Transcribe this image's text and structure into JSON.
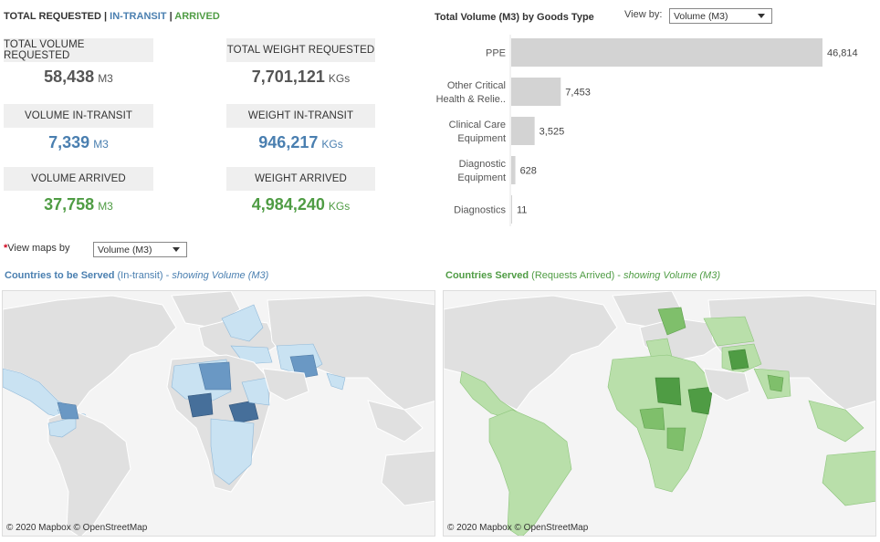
{
  "header": {
    "total": "TOTAL REQUESTED",
    "sep": "|",
    "transit": "IN-TRANSIT",
    "arrived": "ARRIVED"
  },
  "kpis": {
    "total_volume": {
      "label": "TOTAL VOLUME REQUESTED",
      "value": "58,438",
      "unit": "M3"
    },
    "total_weight": {
      "label": "TOTAL WEIGHT REQUESTED",
      "value": "7,701,121",
      "unit": "KGs"
    },
    "volume_transit": {
      "label": "VOLUME IN-TRANSIT",
      "value": "7,339",
      "unit": "M3"
    },
    "weight_transit": {
      "label": "WEIGHT IN-TRANSIT",
      "value": "946,217",
      "unit": "KGs"
    },
    "volume_arrived": {
      "label": "VOLUME ARRIVED",
      "value": "37,758",
      "unit": "M3"
    },
    "weight_arrived": {
      "label": "WEIGHT ARRIVED",
      "value": "4,984,240",
      "unit": "KGs"
    }
  },
  "chart_header": {
    "title": "Total Volume (M3) by Goods Type",
    "view_by_label": "View by:",
    "view_by_value": "Volume (M3)"
  },
  "chart_data": {
    "type": "bar",
    "orientation": "horizontal",
    "categories": [
      [
        "PPE"
      ],
      [
        "Other Critical",
        "Health & Relie.."
      ],
      [
        "Clinical Care",
        "Equipment"
      ],
      [
        "Diagnostic",
        "Equipment"
      ],
      [
        "Diagnostics"
      ]
    ],
    "values": [
      46814,
      7453,
      3525,
      628,
      11
    ],
    "value_labels": [
      "46,814",
      "7,453",
      "3,525",
      "628",
      "11"
    ],
    "title": "Total Volume (M3) by Goods Type",
    "xlim": [
      0,
      46814
    ],
    "bar_color": "#d3d3d3",
    "grid": false
  },
  "maps_control": {
    "star": "*",
    "label": "View maps by",
    "value": "Volume (M3)"
  },
  "map_transit": {
    "title_bold": "Countries to be Served",
    "title_rest": " (In-transit) - ",
    "title_italic": "showing Volume (M3)",
    "attribution": "© 2020 Mapbox  © OpenStreetMap",
    "color": "#4a7fb0"
  },
  "map_arrived": {
    "title_bold": "Countries Served",
    "title_rest": " (Requests Arrived) - ",
    "title_italic": "showing Volume (M3)",
    "attribution": "© 2020 Mapbox  © OpenStreetMap",
    "color": "#4f9c44"
  }
}
